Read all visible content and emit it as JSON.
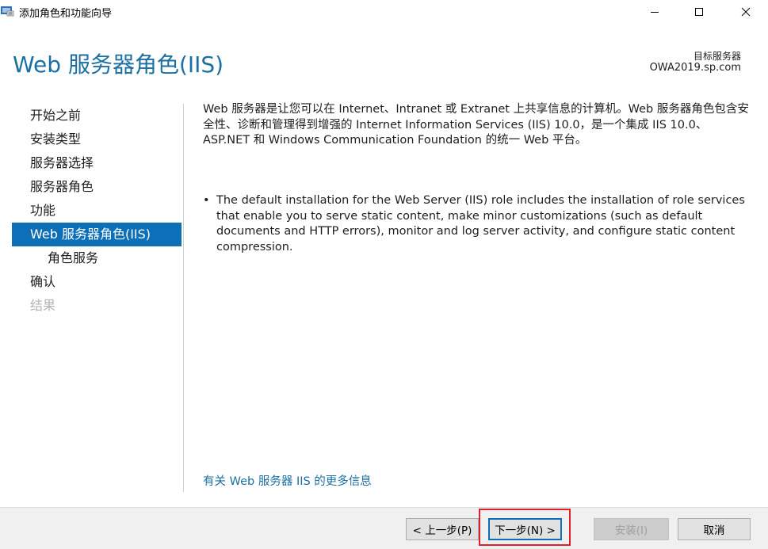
{
  "window": {
    "title": "添加角色和功能向导",
    "icon": "server-manager-icon"
  },
  "header": {
    "title": "Web 服务器角色(IIS)",
    "destination_label": "目标服务器",
    "destination_value": "OWA2019.sp.com"
  },
  "nav": {
    "items": [
      {
        "label": "开始之前",
        "state": "normal"
      },
      {
        "label": "安装类型",
        "state": "normal"
      },
      {
        "label": "服务器选择",
        "state": "normal"
      },
      {
        "label": "服务器角色",
        "state": "normal"
      },
      {
        "label": "功能",
        "state": "normal"
      },
      {
        "label": "Web 服务器角色(IIS)",
        "state": "active"
      },
      {
        "label": "角色服务",
        "state": "sub"
      },
      {
        "label": "确认",
        "state": "normal"
      },
      {
        "label": "结果",
        "state": "disabled"
      }
    ]
  },
  "content": {
    "intro": "Web 服务器是让您可以在 Internet、Intranet 或 Extranet 上共享信息的计算机。Web 服务器角色包含安全性、诊断和管理得到增强的 Internet Information Services (IIS) 10.0，是一个集成 IIS 10.0、ASP.NET 和 Windows Communication Foundation 的统一 Web 平台。",
    "bullets": [
      "The default installation for the Web Server (IIS) role includes the installation of role services that enable you to serve static content, make minor customizations (such as default documents and HTTP errors), monitor and log server activity, and configure static content compression."
    ],
    "more_link": "有关 Web 服务器 IIS 的更多信息"
  },
  "footer": {
    "back_label": "< 上一步(P)",
    "next_label": "下一步(N) >",
    "install_label": "安装(I)",
    "cancel_label": "取消"
  },
  "colors": {
    "accent": "#0d6fb8",
    "title": "#1b6fa3",
    "highlight": "#e0202a"
  }
}
